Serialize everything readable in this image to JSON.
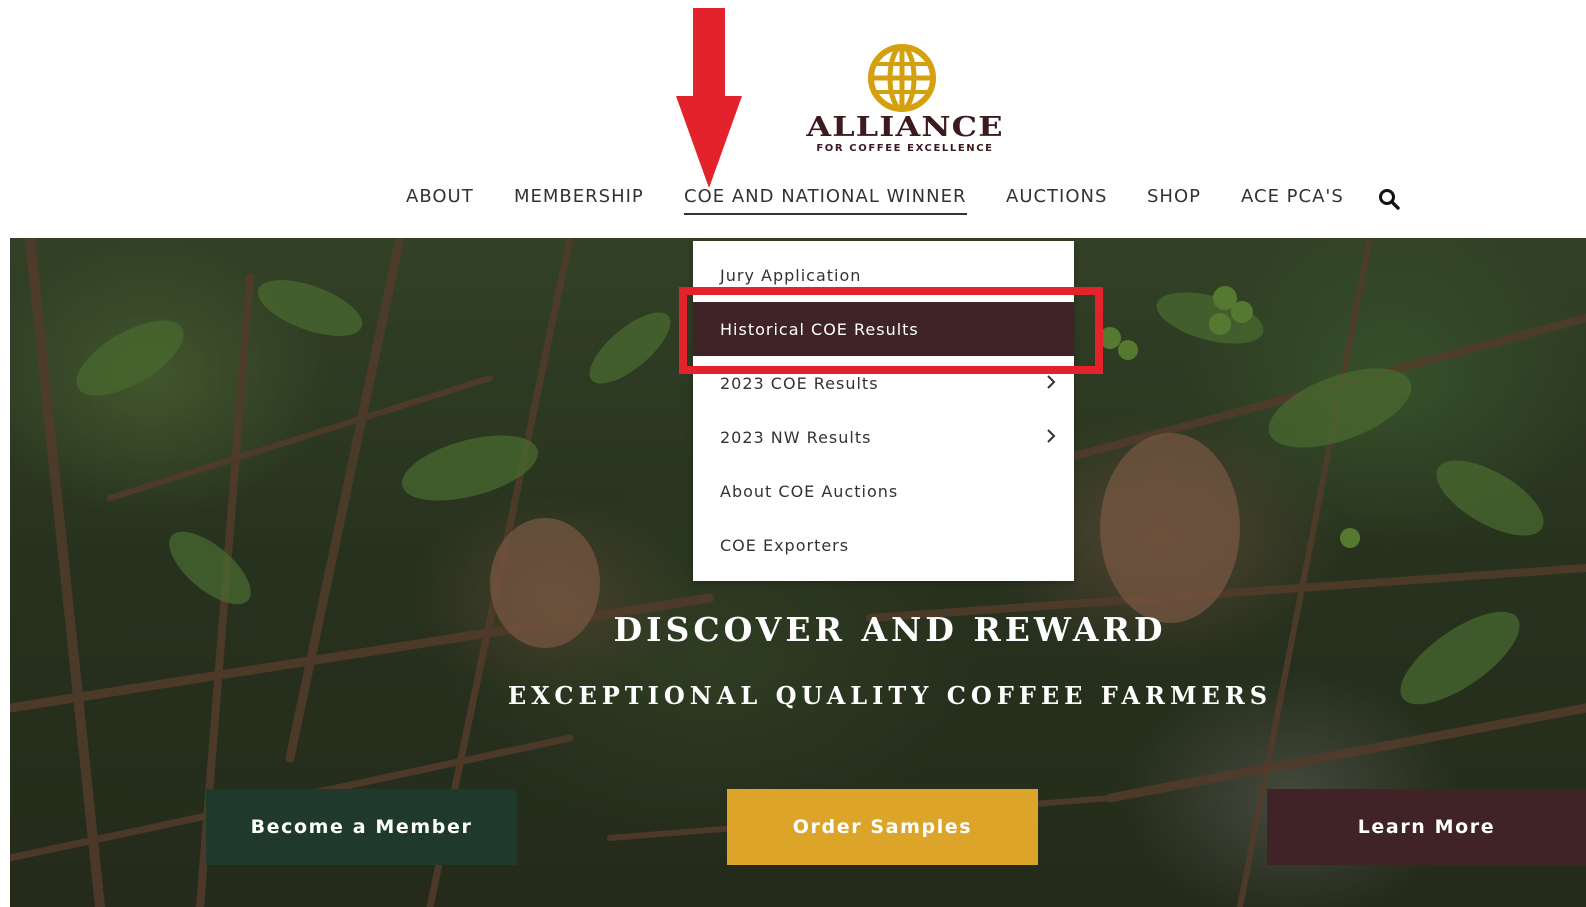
{
  "logo": {
    "brand": "ALLIANCE",
    "tagline": "FOR COFFEE EXCELLENCE",
    "globe_color": "#d4a00e",
    "text_color": "#3d1a1e"
  },
  "nav": {
    "items": [
      {
        "label": "ABOUT"
      },
      {
        "label": "MEMBERSHIP"
      },
      {
        "label": "COE AND NATIONAL WINNER"
      },
      {
        "label": "AUCTIONS"
      },
      {
        "label": "SHOP"
      },
      {
        "label": "ACE PCA'S"
      }
    ],
    "active_index": 2,
    "search_icon": "search-icon"
  },
  "dropdown": {
    "items": [
      {
        "label": "Jury Application"
      },
      {
        "label": "Historical COE Results"
      },
      {
        "label": "2023 COE Results"
      },
      {
        "label": "2023 NW Results"
      },
      {
        "label": "About COE Auctions"
      },
      {
        "label": "COE Exporters"
      }
    ],
    "active_index": 1,
    "submenu_icon": "chevron-right-icon"
  },
  "hero": {
    "headline": "DISCOVER AND REWARD",
    "subheadline": "EXCEPTIONAL QUALITY COFFEE FARMERS",
    "buttons": {
      "member": "Become a Member",
      "order": "Order Samples",
      "learn": "Learn More"
    }
  },
  "colors": {
    "accent_red": "#e3222b",
    "dark_maroon": "#3f2327",
    "dark_green": "#1f3a2c",
    "gold": "#dca52a"
  }
}
